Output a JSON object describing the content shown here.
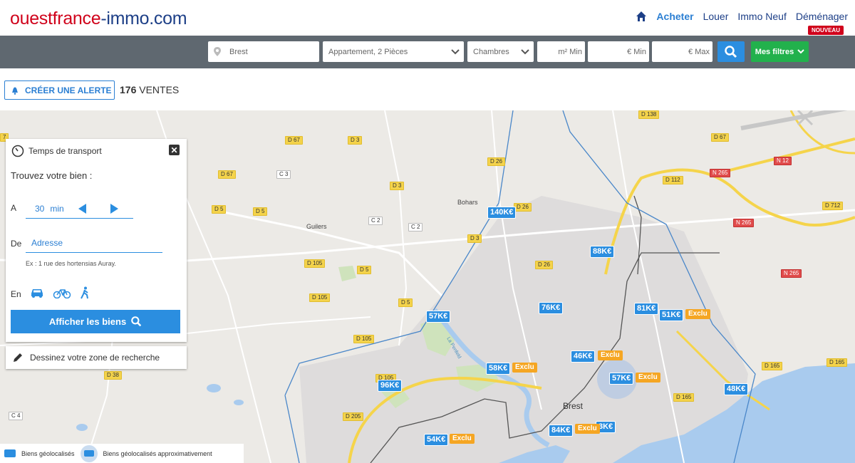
{
  "header": {
    "logo_part1": "ouestfrance",
    "logo_part2": "-immo.com",
    "nav": {
      "acheter": "Acheter",
      "louer": "Louer",
      "immo_neuf": "Immo Neuf",
      "demenager": "Déménager",
      "badge": "NOUVEAU"
    }
  },
  "search": {
    "location": "Brest",
    "type": "Appartement, 2 Pièces",
    "rooms_placeholder": "Chambres",
    "m2_placeholder": "m² Min",
    "price_min_placeholder": "€ Min",
    "price_max_placeholder": "€ Max",
    "filters_label": "Mes filtres"
  },
  "alert": {
    "button_label": "CRÉER UNE ALERTE",
    "count": "176",
    "count_suffix": "VENTES"
  },
  "transport": {
    "title": "Temps de transport",
    "subtitle": "Trouvez votre bien :",
    "label_a": "A",
    "time_value": "30",
    "time_unit": "min",
    "label_de": "De",
    "address_placeholder": "Adresse",
    "example": "Ex : 1 rue des hortensias Auray.",
    "label_en": "En",
    "show_button": "Afficher les biens"
  },
  "draw_zone": "Dessinez votre zone de recherche",
  "legend": {
    "located": "Biens géolocalisés",
    "approx": "Biens géolocalisés approximativement"
  },
  "map": {
    "places": {
      "bohars": "Bohars",
      "guilers": "Guilers",
      "brest": "Brest",
      "penfeld": "La Penfeld"
    },
    "roads": [
      "D 67",
      "D 3",
      "D 26",
      "D 67",
      "C 3",
      "D 3",
      "D 5",
      "D 5",
      "C 2",
      "C 2",
      "D 3",
      "D 26",
      "D 105",
      "D 5",
      "D 105",
      "D 5",
      "D 105",
      "D 38",
      "C 4",
      "D 205",
      "D 105",
      "D 26",
      "D 26",
      "D 138",
      "D 112",
      "N 265",
      "N 12",
      "D 67",
      "D 712",
      "N 265",
      "N 265",
      "D 165",
      "D 165",
      "D 165",
      "7"
    ],
    "prices": [
      "140K€",
      "88K€",
      "81K€",
      "51K€",
      "76K€",
      "57K€",
      "46K€",
      "58K€",
      "57K€",
      "96K€",
      "48K€",
      "54K€",
      "84K€",
      "3K€"
    ],
    "exclu": "Exclu"
  }
}
